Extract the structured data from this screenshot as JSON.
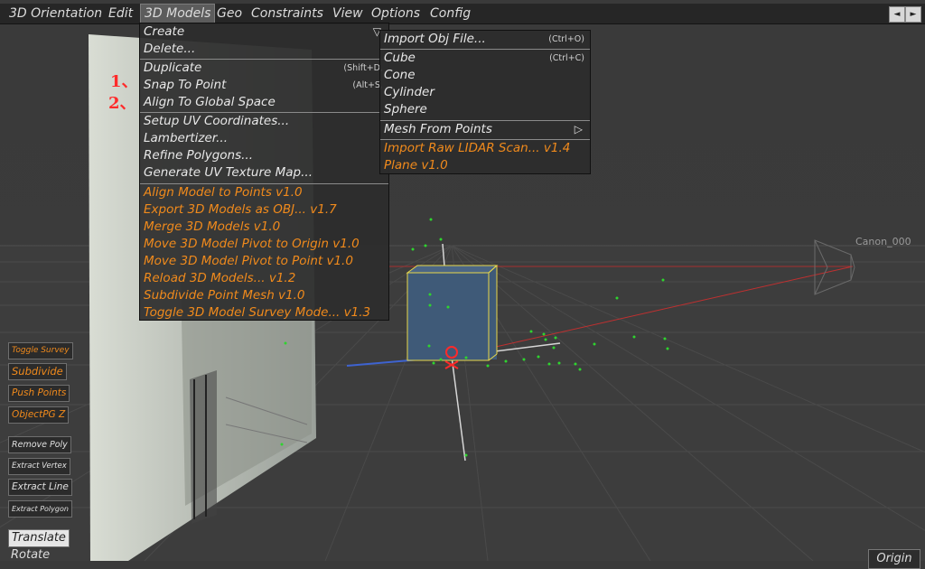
{
  "menubar": {
    "items": [
      "3D Orientation",
      "Edit",
      "3D Models",
      "Geo",
      "Constraints",
      "View",
      "Options",
      "Config"
    ],
    "active": "3D Models",
    "scroll_left": "◄",
    "scroll_right": "►"
  },
  "models_menu": {
    "items": [
      {
        "label": "Create",
        "shortcut": ""
      },
      {
        "label": "Delete...",
        "shortcut": ""
      },
      {
        "label": "Duplicate",
        "shortcut": "(Shift+D,"
      },
      {
        "label": "Snap To Point",
        "shortcut": "(Alt+S,"
      },
      {
        "label": "Align To Global Space",
        "shortcut": ""
      },
      {
        "label": "Setup UV Coordinates...",
        "shortcut": ""
      },
      {
        "label": "Lambertizer...",
        "shortcut": ""
      },
      {
        "label": "Refine Polygons...",
        "shortcut": ""
      },
      {
        "label": "Generate UV Texture Map...",
        "shortcut": ""
      },
      {
        "label": "Align Model to Points  v1.0",
        "shortcut": ""
      },
      {
        "label": "Export 3D Models as OBJ...  v1.7",
        "shortcut": ""
      },
      {
        "label": "Merge 3D Models  v1.0",
        "shortcut": ""
      },
      {
        "label": "Move 3D Model Pivot to Origin  v1.0",
        "shortcut": ""
      },
      {
        "label": "Move 3D Model Pivot to Point  v1.0",
        "shortcut": ""
      },
      {
        "label": "Reload 3D Models...  v1.2",
        "shortcut": ""
      },
      {
        "label": "Subdivide Point Mesh  v1.0",
        "shortcut": ""
      },
      {
        "label": "Toggle 3D Model Survey Mode...  v1.3",
        "shortcut": ""
      }
    ],
    "create_arrow": "▽"
  },
  "create_submenu": {
    "items": [
      {
        "label": "Import Obj File...",
        "shortcut": "(Ctrl+O)"
      },
      {
        "label": "Cube",
        "shortcut": "(Ctrl+C)"
      },
      {
        "label": "Cone",
        "shortcut": ""
      },
      {
        "label": "Cylinder",
        "shortcut": ""
      },
      {
        "label": "Sphere",
        "shortcut": ""
      },
      {
        "label": "Mesh From Points",
        "shortcut": ""
      },
      {
        "label": "Import Raw LIDAR Scan...  v1.4",
        "shortcut": ""
      },
      {
        "label": "Plane  v1.0",
        "shortcut": ""
      }
    ],
    "mesh_arrow": "▷"
  },
  "annotations": {
    "one": "1、",
    "two": "2、"
  },
  "tools": {
    "toggle_survey": "Toggle Survey",
    "subdivide": "Subdivide",
    "push_points": "Push Points",
    "objectpg_z": "ObjectPG Z",
    "remove_poly": "Remove Poly",
    "extract_vertex": "Extract Vertex",
    "extract_line": "Extract Line",
    "extract_polygon": "Extract Polygon",
    "translate": "Translate",
    "rotate": "Rotate"
  },
  "origin_button": "Origin",
  "camera_label": "Canon_000",
  "colors": {
    "accent_orange": "#f08a1c",
    "annotation_red": "#ff2a2a",
    "cube_fill": "#3f5a78",
    "cube_edge": "#e8d84a",
    "point_green": "#2ed52e"
  }
}
